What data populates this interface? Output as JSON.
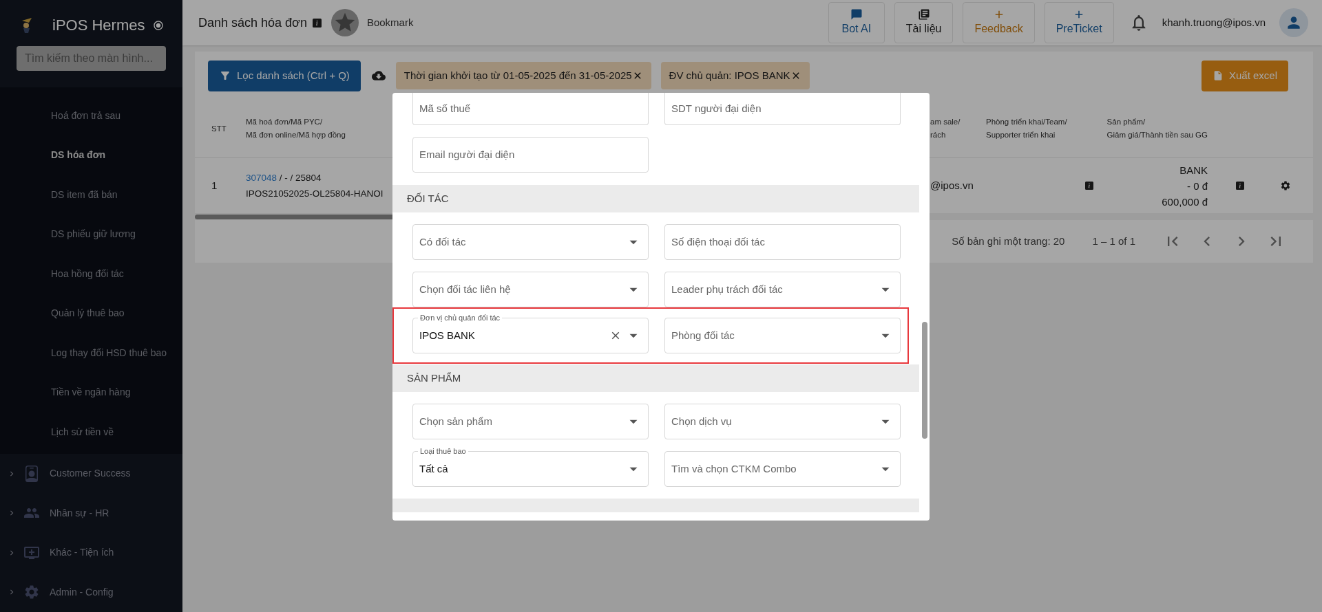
{
  "sidebar": {
    "app_name": "iPOS Hermes",
    "search": {
      "placeholder": "Tìm kiếm theo màn hình..."
    },
    "submenu": [
      {
        "label": "Hoá đơn trả sau",
        "selected": false
      },
      {
        "label": "DS hóa đơn",
        "selected": true
      },
      {
        "label": "DS item đã bán",
        "selected": false
      },
      {
        "label": "DS phiếu giữ lương",
        "selected": false
      },
      {
        "label": "Hoa hồng đối tác",
        "selected": false
      },
      {
        "label": "Quản lý thuê bao",
        "selected": false
      },
      {
        "label": "Log thay đổi HSD thuê bao",
        "selected": false
      },
      {
        "label": "Tiền về ngân hàng",
        "selected": false
      },
      {
        "label": "Lịch sử tiền về",
        "selected": false
      }
    ],
    "groups": [
      {
        "label": "Customer Success",
        "expanded": false
      },
      {
        "label": "Nhân sự - HR",
        "expanded": false
      },
      {
        "label": "Khác - Tiện ích",
        "expanded": false
      },
      {
        "label": "Admin - Config",
        "expanded": false
      }
    ]
  },
  "header": {
    "title": "Danh sách hóa đơn",
    "bookmark": "Bookmark",
    "buttons": [
      {
        "label": "Bot AI",
        "kind": "primary"
      },
      {
        "label": "Tài liệu",
        "kind": "plain"
      },
      {
        "label": "Feedback",
        "kind": "accent"
      },
      {
        "label": "PreTicket",
        "kind": "primary"
      }
    ],
    "user_email": "khanh.truong@ipos.vn"
  },
  "toolbar": {
    "filter_button": "Lọc danh sách (Ctrl + Q)",
    "chips": [
      {
        "label": "Thời gian khởi tạo từ 01-05-2025 đến 31-05-2025"
      },
      {
        "label": "ĐV chủ quản: IPOS BANK"
      }
    ],
    "export_button": "Xuất excel"
  },
  "table": {
    "columns": [
      {
        "lines": [
          "STT"
        ]
      },
      {
        "lines": [
          "Mã hoá đơn/Mã PYC/",
          "Mã đơn online/Mã hợp đồng"
        ]
      },
      {
        "lines": [
          "am sale/",
          "rách"
        ]
      },
      {
        "lines": [
          "Phòng triển khai/Team/",
          "Supporter triển khai"
        ]
      },
      {
        "lines": [
          "Sản phẩm/",
          "Giảm giá/Thành tiền sau GG"
        ]
      }
    ],
    "rows": [
      {
        "stt": "1",
        "code_link": "307048",
        "code_rest": " / - / 25804",
        "code_line2": "IPOS21052025-OL25804-HANOI",
        "column_3": "@ipos.vn",
        "product": [
          "BANK",
          "- 0 đ",
          "600,000 đ"
        ]
      }
    ]
  },
  "pagination": {
    "page_size": "Số bản ghi một trang: 20",
    "range": "1 – 1 of 1"
  },
  "modal": {
    "rows": [
      {
        "kind": "fields",
        "cut_top": true,
        "highlighted": false,
        "fields": [
          {
            "kind": "text",
            "placeholder": "Mã số thuế"
          },
          {
            "kind": "text",
            "placeholder": "SDT người đại diện"
          }
        ]
      },
      {
        "kind": "fields",
        "cut_top": false,
        "highlighted": false,
        "fields": [
          {
            "kind": "text",
            "placeholder": "Email người đại diện"
          }
        ]
      },
      {
        "kind": "section",
        "title": "ĐỐI TÁC"
      },
      {
        "kind": "fields",
        "cut_top": false,
        "highlighted": false,
        "fields": [
          {
            "kind": "select",
            "placeholder": "Có đối tác"
          },
          {
            "kind": "text",
            "placeholder": "Số điện thoại đối tác"
          }
        ]
      },
      {
        "kind": "fields",
        "cut_top": false,
        "highlighted": false,
        "fields": [
          {
            "kind": "select",
            "placeholder": "Chọn đối tác liên hệ"
          },
          {
            "kind": "select",
            "placeholder": "Leader phụ trách đối tác"
          }
        ]
      },
      {
        "kind": "fields",
        "cut_top": false,
        "highlighted": true,
        "fields": [
          {
            "kind": "select",
            "label": "Đơn vị chủ quản đối tác",
            "value": "IPOS BANK",
            "clearable": true
          },
          {
            "kind": "select",
            "placeholder": "Phòng đối tác"
          }
        ]
      },
      {
        "kind": "section",
        "title": "SẢN PHẨM"
      },
      {
        "kind": "fields",
        "cut_top": false,
        "highlighted": false,
        "fields": [
          {
            "kind": "select",
            "placeholder": "Chọn sản phẩm"
          },
          {
            "kind": "select",
            "placeholder": "Chọn dịch vụ"
          }
        ]
      },
      {
        "kind": "fields",
        "cut_top": false,
        "highlighted": false,
        "fields": [
          {
            "kind": "select",
            "label": "Loại thuê bao",
            "value": "Tất cả"
          },
          {
            "kind": "select",
            "placeholder": "Tìm và chọn CTKM Combo"
          }
        ]
      }
    ]
  }
}
